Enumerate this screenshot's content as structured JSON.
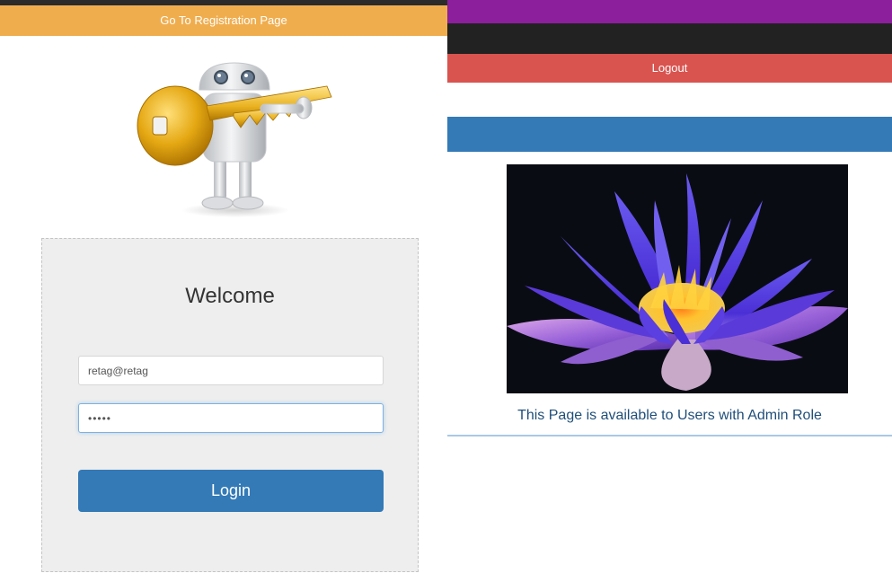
{
  "left_panel": {
    "registration_link": "Go To Registration Page",
    "welcome_heading": "Welcome",
    "email_value": "retag@retag",
    "password_value": "•••••",
    "login_label": "Login",
    "illustration": "robot-holding-key-icon"
  },
  "right_panel": {
    "logout_label": "Logout",
    "image": "lotus-flower-photo",
    "admin_message": "This Page is available to Users with Admin Role"
  },
  "colors": {
    "registration_bar": "#f0ad4e",
    "purple_bar": "#8b1f9c",
    "dark_bar": "#222222",
    "logout_bar": "#d9534f",
    "primary_blue": "#337ab7",
    "card_background": "#eeeeee"
  }
}
